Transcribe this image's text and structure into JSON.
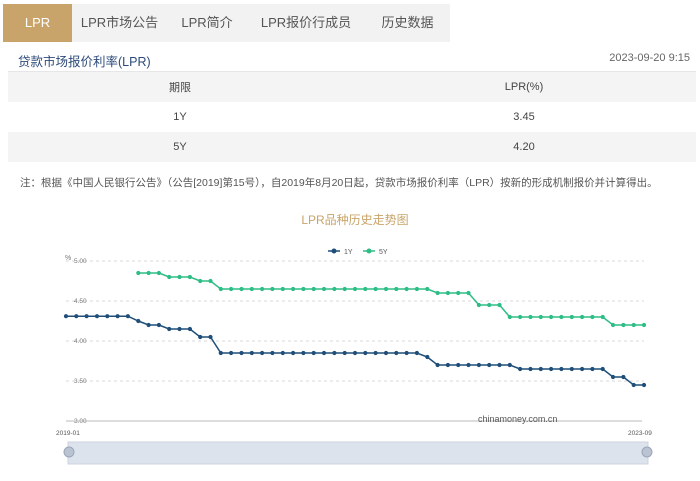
{
  "tabs": [
    {
      "label": "LPR",
      "active": true
    },
    {
      "label": "LPR市场公告",
      "active": false
    },
    {
      "label": "LPR简介",
      "active": false
    },
    {
      "label": "LPR报价行成员",
      "active": false
    },
    {
      "label": "历史数据",
      "active": false
    }
  ],
  "section": {
    "title": "贷款市场报价利率(LPR)",
    "timestamp": "2023-09-20 9:15"
  },
  "table": {
    "headers": [
      "期限",
      "LPR(%)"
    ],
    "rows": [
      {
        "term": "1Y",
        "rate": "3.45"
      },
      {
        "term": "5Y",
        "rate": "4.20"
      }
    ]
  },
  "note": "注：根据《中国人民银行公告》（公告[2019]第15号），自2019年8月20日起，贷款市场报价利率（LPR）按新的形成机制报价并计算得出。",
  "colors": {
    "accent": "#c9a46a",
    "series_1y": "#1f4e79",
    "series_5y": "#2ebd85",
    "title_blue": "#2c4a7a"
  },
  "chart_data": {
    "type": "line",
    "title": "LPR品种历史走势图",
    "ylabel": "%",
    "ylim": [
      3.0,
      5.0
    ],
    "yticks": [
      "5.00",
      "4.50",
      "4.00",
      "3.50",
      "3.00"
    ],
    "x_start_label": "2019-01",
    "x_end_label": "2023-09",
    "watermark": "chinamoney.com.cn",
    "legend_position": "top",
    "grid": true,
    "series": [
      {
        "name": "1Y",
        "values": [
          4.31,
          4.31,
          4.31,
          4.31,
          4.31,
          4.31,
          4.31,
          4.25,
          4.2,
          4.2,
          4.15,
          4.15,
          4.15,
          4.05,
          4.05,
          3.85,
          3.85,
          3.85,
          3.85,
          3.85,
          3.85,
          3.85,
          3.85,
          3.85,
          3.85,
          3.85,
          3.85,
          3.85,
          3.85,
          3.85,
          3.85,
          3.85,
          3.85,
          3.85,
          3.85,
          3.8,
          3.7,
          3.7,
          3.7,
          3.7,
          3.7,
          3.7,
          3.7,
          3.7,
          3.65,
          3.65,
          3.65,
          3.65,
          3.65,
          3.65,
          3.65,
          3.65,
          3.65,
          3.55,
          3.55,
          3.45,
          3.45
        ]
      },
      {
        "name": "5Y",
        "values": [
          null,
          null,
          null,
          null,
          null,
          null,
          null,
          4.85,
          4.85,
          4.85,
          4.8,
          4.8,
          4.8,
          4.75,
          4.75,
          4.65,
          4.65,
          4.65,
          4.65,
          4.65,
          4.65,
          4.65,
          4.65,
          4.65,
          4.65,
          4.65,
          4.65,
          4.65,
          4.65,
          4.65,
          4.65,
          4.65,
          4.65,
          4.65,
          4.65,
          4.65,
          4.6,
          4.6,
          4.6,
          4.6,
          4.45,
          4.45,
          4.45,
          4.3,
          4.3,
          4.3,
          4.3,
          4.3,
          4.3,
          4.3,
          4.3,
          4.3,
          4.3,
          4.2,
          4.2,
          4.2,
          4.2
        ]
      }
    ]
  }
}
